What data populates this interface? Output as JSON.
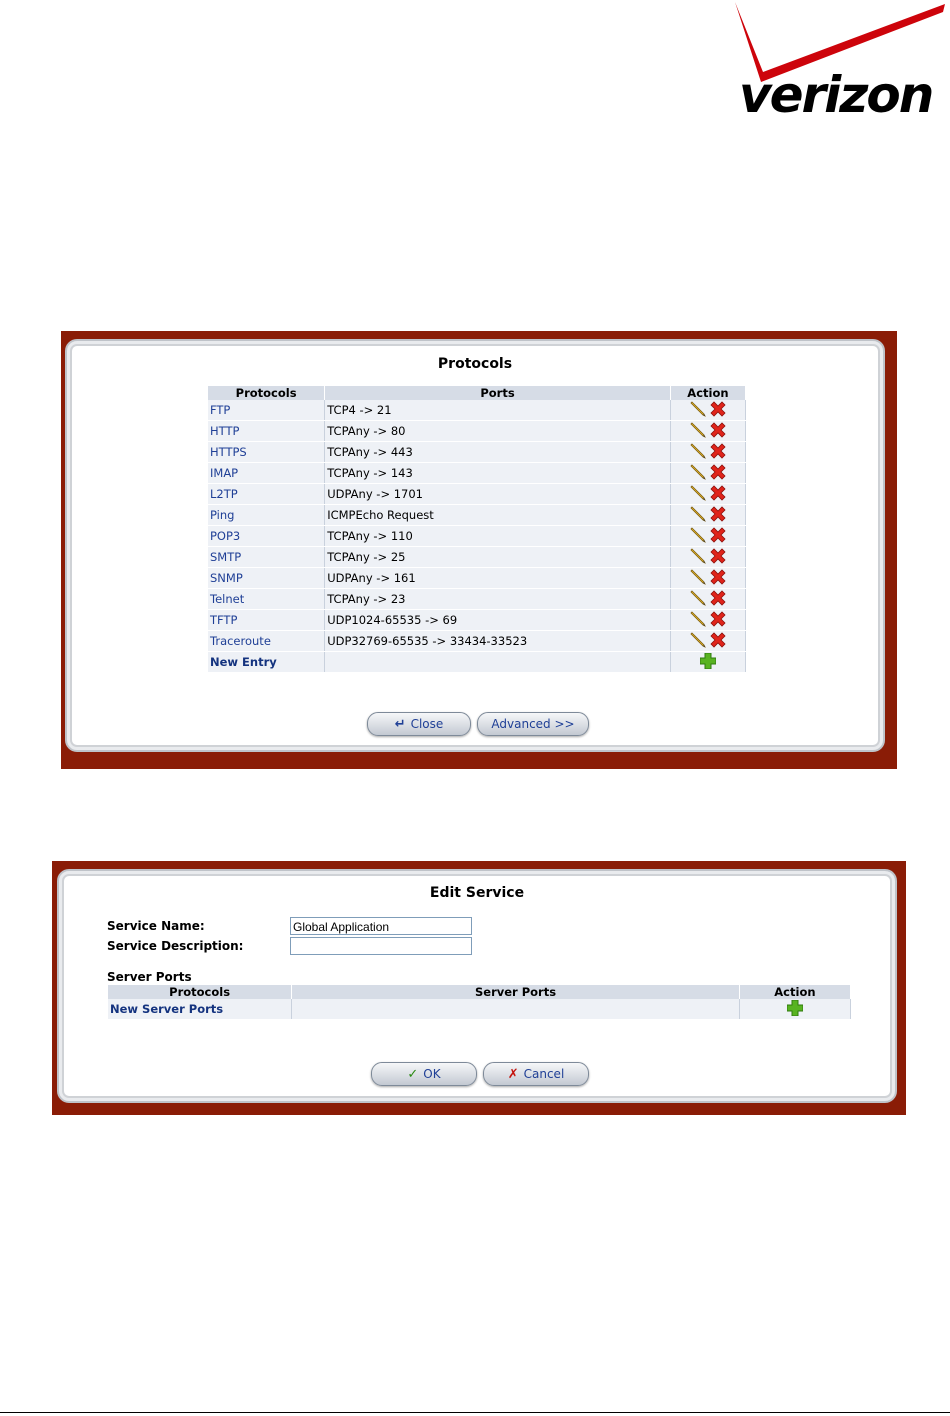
{
  "logo": {
    "text": "verizon"
  },
  "protocols_dialog": {
    "title": "Protocols",
    "columns": [
      "Protocols",
      "Ports",
      "Action"
    ],
    "rows": [
      {
        "protocol": "FTP",
        "ports": "TCP4 -> 21"
      },
      {
        "protocol": "HTTP",
        "ports": "TCPAny -> 80"
      },
      {
        "protocol": "HTTPS",
        "ports": "TCPAny -> 443"
      },
      {
        "protocol": "IMAP",
        "ports": "TCPAny -> 143"
      },
      {
        "protocol": "L2TP",
        "ports": "UDPAny -> 1701"
      },
      {
        "protocol": "Ping",
        "ports": "ICMPEcho Request"
      },
      {
        "protocol": "POP3",
        "ports": "TCPAny -> 110"
      },
      {
        "protocol": "SMTP",
        "ports": "TCPAny -> 25"
      },
      {
        "protocol": "SNMP",
        "ports": "UDPAny -> 161"
      },
      {
        "protocol": "Telnet",
        "ports": "TCPAny -> 23"
      },
      {
        "protocol": "TFTP",
        "ports": "UDP1024-65535 -> 69"
      },
      {
        "protocol": "Traceroute",
        "ports": "UDP32769-65535 -> 33434-33523"
      }
    ],
    "new_entry_label": "New Entry",
    "close_label": "Close",
    "advanced_label": "Advanced >>"
  },
  "edit_service_dialog": {
    "title": "Edit Service",
    "service_name_label": "Service Name:",
    "service_name_value": "Global Application",
    "service_description_label": "Service Description:",
    "service_description_value": "",
    "server_ports_heading": "Server Ports",
    "columns": [
      "Protocols",
      "Server Ports",
      "Action"
    ],
    "new_server_ports_label": "New Server Ports",
    "ok_label": "OK",
    "cancel_label": "Cancel"
  },
  "colors": {
    "frame": "#8a1c06",
    "link": "#1f3f96",
    "header_bg": "#d6dce6",
    "row_bg": "#eef1f6",
    "brand_red": "#cd040b"
  }
}
